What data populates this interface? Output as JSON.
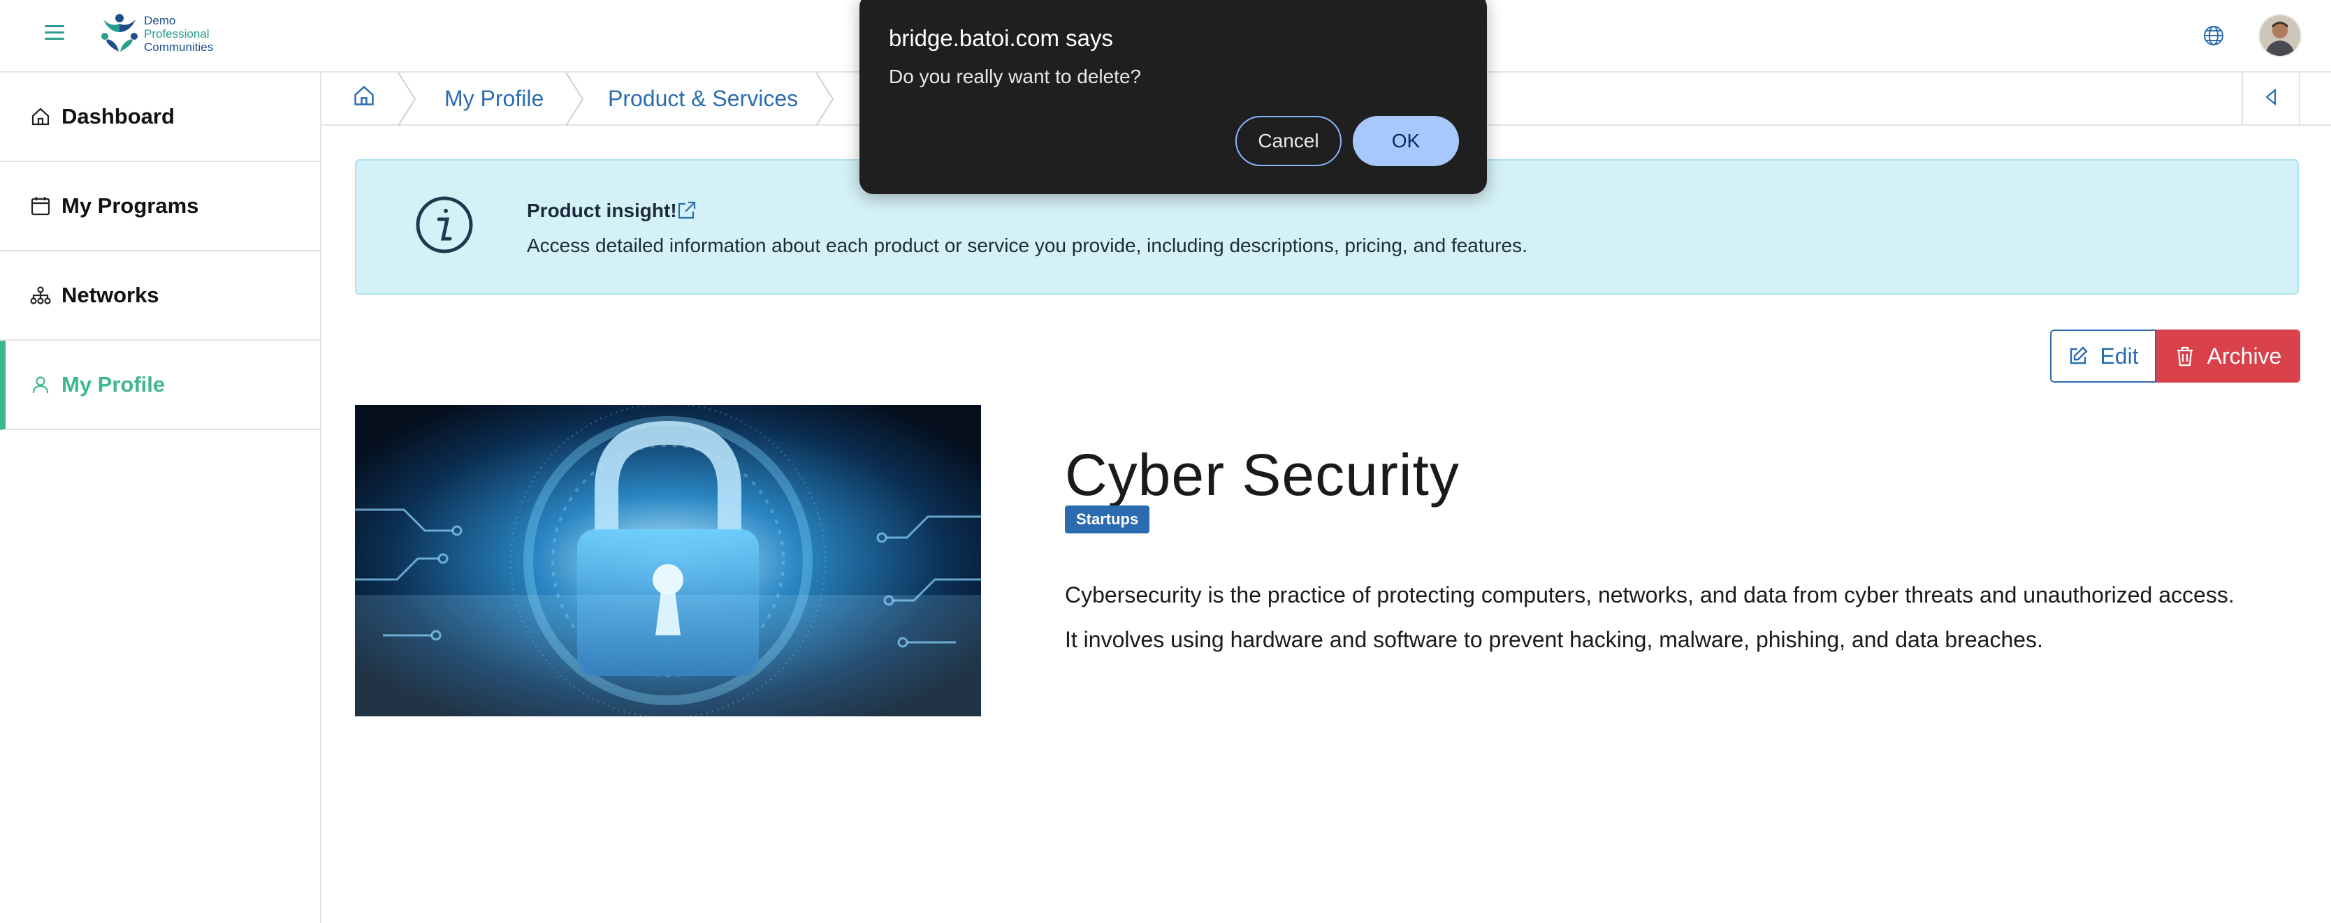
{
  "header": {
    "logo_lines": [
      "Demo",
      "Professional",
      "Communities"
    ],
    "globe_icon": "globe-icon",
    "avatar_icon": "user-avatar"
  },
  "sidebar": {
    "items": [
      {
        "label": "Dashboard",
        "icon": "home-icon",
        "active": false
      },
      {
        "label": "My Programs",
        "icon": "calendar-icon",
        "active": false
      },
      {
        "label": "Networks",
        "icon": "network-icon",
        "active": false
      },
      {
        "label": "My Profile",
        "icon": "user-icon",
        "active": true
      }
    ]
  },
  "breadcrumb": {
    "home_icon": "home-icon",
    "items": [
      "My Profile",
      "Product & Services"
    ]
  },
  "alert": {
    "title": "Product insight!",
    "description": "Access detailed information about each product or service you provide, including descriptions, pricing, and features."
  },
  "actions": {
    "edit_label": "Edit",
    "archive_label": "Archive"
  },
  "product": {
    "name": "Cyber Security",
    "tag": "Startups",
    "description": "Cybersecurity is the practice of protecting computers, networks, and data from cyber threats and unauthorized access. It involves using hardware and software to prevent hacking, malware, phishing, and data breaches."
  },
  "dialog": {
    "title": "bridge.batoi.com says",
    "message": "Do you really want to delete?",
    "cancel_label": "Cancel",
    "ok_label": "OK"
  },
  "colors": {
    "accent_green": "#3db88a",
    "link_blue": "#2b6cb0",
    "danger_red": "#d9424b",
    "alert_bg": "#d5f1f8",
    "dialog_bg": "#1f1f1f"
  }
}
